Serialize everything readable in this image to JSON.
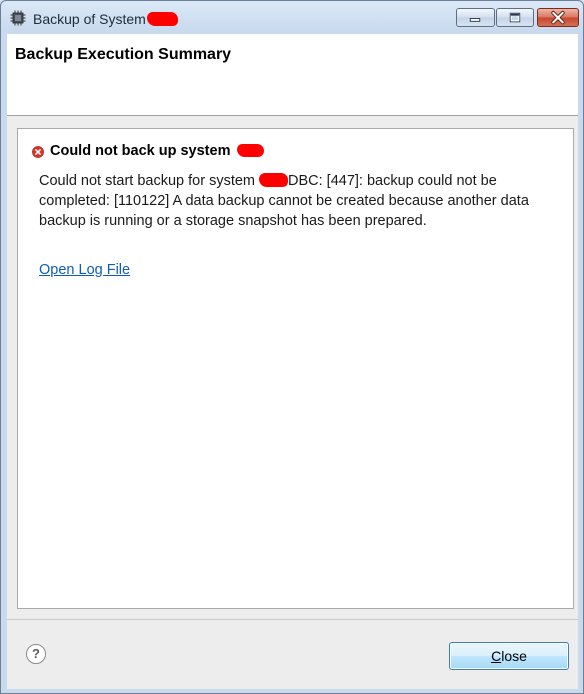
{
  "window": {
    "title": "Backup of System",
    "controls": {
      "minimize": "minimize-icon",
      "maximize": "maximize-icon",
      "close": "close-icon"
    }
  },
  "header": {
    "title": "Backup Execution Summary"
  },
  "error": {
    "icon": "error-icon",
    "title": "Could not back up system",
    "message_part1": "Could not start backup for system ",
    "message_part2": "DBC: [447]: backup could not be completed: [110122] A data backup cannot be created because another data backup is running or a storage snapshot has been prepared."
  },
  "links": {
    "open_log": "Open Log File"
  },
  "footer": {
    "help_icon": "help-icon",
    "help_glyph": "?",
    "close_mnemonic": "C",
    "close_rest": "lose"
  },
  "colors": {
    "link": "#0b5fb3",
    "error_red": "#d9342b",
    "redaction": "#ff0000"
  }
}
